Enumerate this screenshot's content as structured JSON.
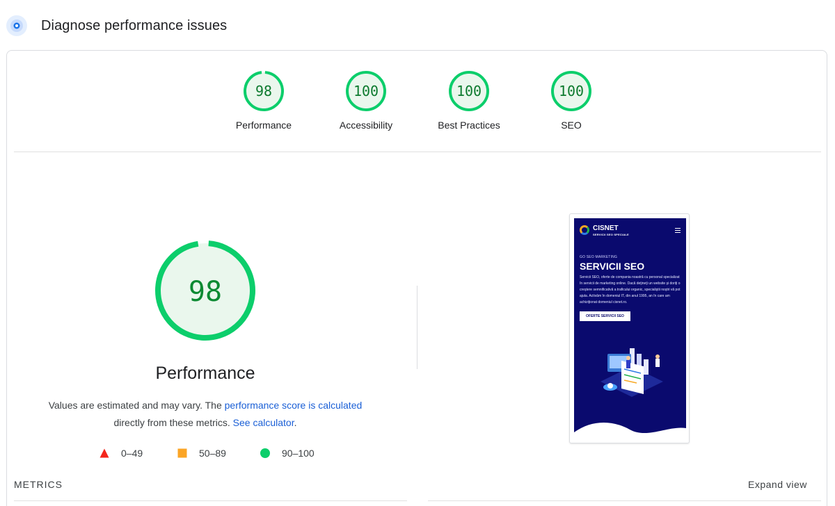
{
  "header": {
    "title": "Diagnose performance issues",
    "icon": "diagnose-target-icon"
  },
  "category_scores": [
    {
      "label": "Performance",
      "score": "98"
    },
    {
      "label": "Accessibility",
      "score": "100"
    },
    {
      "label": "Best Practices",
      "score": "100"
    },
    {
      "label": "SEO",
      "score": "100"
    }
  ],
  "performance": {
    "score": "98",
    "title": "Performance",
    "desc_part1": "Values are estimated and may vary. The ",
    "desc_link1": "performance score is calculated",
    "desc_part2": "directly from these metrics. ",
    "desc_link2": "See calculator",
    "desc_end": "."
  },
  "legend": [
    {
      "range": "0–49",
      "shape": "triangle",
      "color": "#f4261c"
    },
    {
      "range": "50–89",
      "shape": "square",
      "color": "#fba526"
    },
    {
      "range": "90–100",
      "shape": "circle",
      "color": "#0cce6b"
    }
  ],
  "screenshot": {
    "logo_name": "CISNET",
    "logo_tagline": "SERVICII SEO SPECIALE",
    "kicker": "GO SEO MARKETING",
    "hero_title": "SERVICII SEO",
    "hero_text": "Servicii SEO, oferte de compania noastră cu personal specializat în servicii de marketing online. Dacă deţineţi un website şi doriţi o creştere semnificativă a traficului organic, specialiştii noştri vă pot ajuta. Activăm în domeniul IT, din anul 1995, an în care am achiziţionat domeniul cisnet.ro.",
    "hero_button": "OFERTE SERVICII SEO"
  },
  "metrics": {
    "label": "METRICS",
    "expand": "Expand view"
  },
  "colors": {
    "pass": "#0cce6b",
    "pass_fill": "#eaf7ed",
    "link": "#1a5fd6",
    "phone_bg": "#0a0a6e"
  }
}
